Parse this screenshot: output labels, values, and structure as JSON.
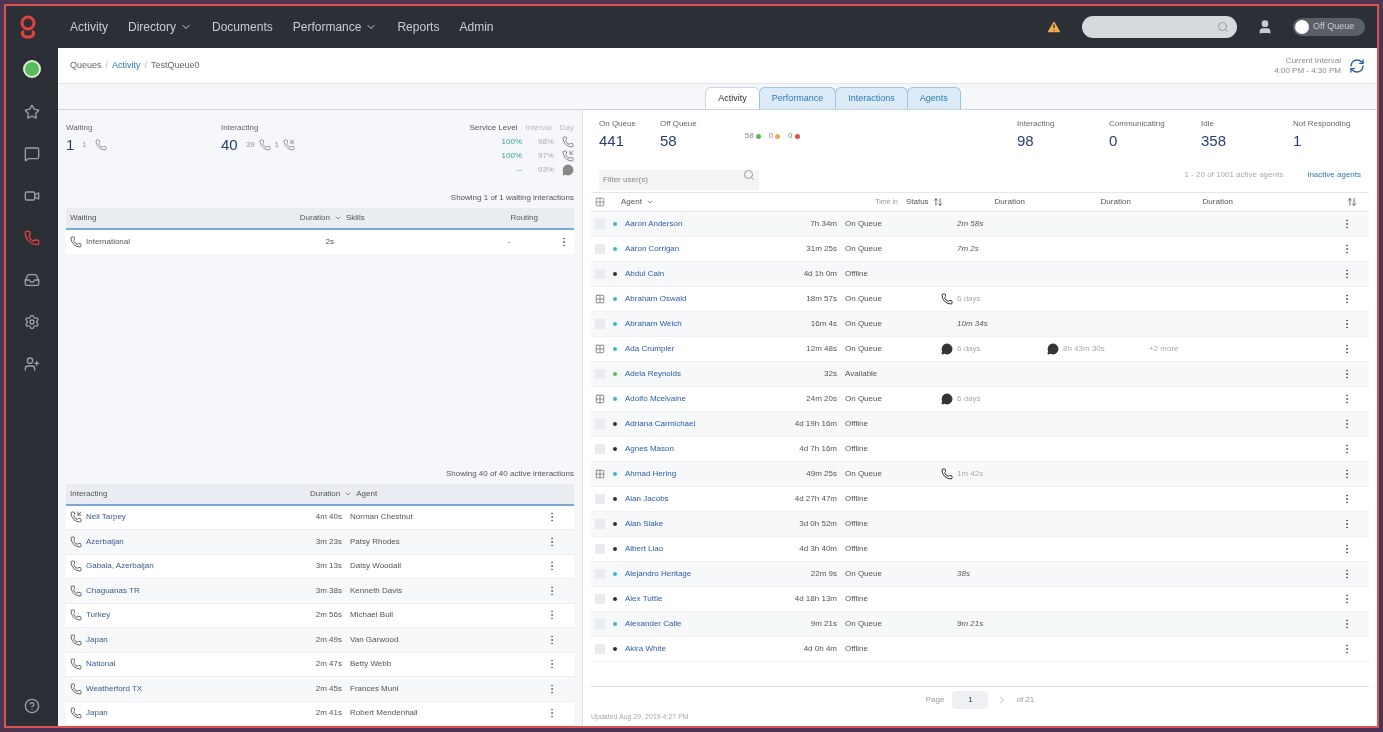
{
  "nav": {
    "items": [
      {
        "label": "Activity",
        "dropdown": false
      },
      {
        "label": "Directory",
        "dropdown": true
      },
      {
        "label": "Documents",
        "dropdown": false
      },
      {
        "label": "Performance",
        "dropdown": true
      },
      {
        "label": "Reports",
        "dropdown": false
      },
      {
        "label": "Admin",
        "dropdown": false
      }
    ],
    "status_toggle": {
      "label": "Off Queue",
      "on": false
    }
  },
  "breadcrumb": {
    "separator": "/",
    "items": [
      "Queues",
      "Activity",
      "TestQueue0"
    ]
  },
  "interval": {
    "label": "Current Interval",
    "range": "4:00 PM - 4:30 PM"
  },
  "tabs": [
    {
      "label": "Activity",
      "selected": true
    },
    {
      "label": "Performance",
      "selected": false
    },
    {
      "label": "Interactions",
      "selected": false
    },
    {
      "label": "Agents",
      "selected": false
    }
  ],
  "left": {
    "waiting": {
      "label": "Waiting",
      "value": "1",
      "calls": "1"
    },
    "interacting": {
      "label": "Interacting",
      "value": "40",
      "calls": "39",
      "callbacks": "1"
    },
    "service_level": {
      "label": "Service Level",
      "interval_label": "Interval",
      "day_label": "Day",
      "rows": [
        {
          "kind": "call",
          "interval": "100%",
          "day": "98%"
        },
        {
          "kind": "callback",
          "interval": "100%",
          "day": "97%"
        },
        {
          "kind": "chat",
          "interval": "--",
          "day": "93%"
        }
      ]
    },
    "waiting_table": {
      "summary": "Showing 1 of 1 waiting interactions",
      "columns": [
        "Waiting",
        "Duration",
        "Skills",
        "Routing"
      ],
      "rows": [
        {
          "kind": "call",
          "name": "International",
          "duration": "2s",
          "skills": "",
          "routing": "-"
        }
      ]
    },
    "interacting_table": {
      "summary": "Showing 40 of 40 active interactions",
      "columns": [
        "Interacting",
        "Duration",
        "Agent"
      ],
      "rows": [
        {
          "kind": "callback",
          "name": "Neil Tarpey",
          "duration": "4m 40s",
          "agent": "Norman Chestnut"
        },
        {
          "kind": "call",
          "name": "Azerbaijan",
          "duration": "3m 23s",
          "agent": "Patsy Rhodes"
        },
        {
          "kind": "call",
          "name": "Gabala, Azerbaijan",
          "duration": "3m 13s",
          "agent": "Daisy Woodall"
        },
        {
          "kind": "call",
          "name": "Chaguanas TR",
          "duration": "3m 38s",
          "agent": "Kenneth Davis"
        },
        {
          "kind": "call",
          "name": "Turkey",
          "duration": "2m 56s",
          "agent": "Michael Bull"
        },
        {
          "kind": "call",
          "name": "Japan",
          "duration": "2m 49s",
          "agent": "Van Garwood"
        },
        {
          "kind": "call",
          "name": "National",
          "duration": "2m 47s",
          "agent": "Betty Webb"
        },
        {
          "kind": "call",
          "name": "Weatherford TX",
          "duration": "2m 45s",
          "agent": "Frances Muni"
        },
        {
          "kind": "call",
          "name": "Japan",
          "duration": "2m 41s",
          "agent": "Robert Mendenhall"
        }
      ]
    }
  },
  "right": {
    "stats": [
      {
        "label": "On Queue",
        "value": "441"
      },
      {
        "label": "Off Queue",
        "value": "58"
      }
    ],
    "status_counts": [
      {
        "value": "58",
        "color": "#5cb85c"
      },
      {
        "value": "0",
        "color": "#f0ad4e"
      },
      {
        "value": "0",
        "color": "#d9534f"
      }
    ],
    "stats_right": [
      {
        "label": "Interacting",
        "value": "98"
      },
      {
        "label": "Communicating",
        "value": "0"
      },
      {
        "label": "Idle",
        "value": "358"
      },
      {
        "label": "Not Responding",
        "value": "1"
      }
    ],
    "filter": {
      "placeholder": "Filter user(s)"
    },
    "count": "1 - 20 of 1001 active agents",
    "inactive_link": "Inactive agents",
    "columns": [
      "Agent",
      "Time in",
      "Status",
      "Duration",
      "Duration",
      "Duration"
    ],
    "rows": [
      {
        "name": "Aaron Anderson",
        "color": "#3bb5c9",
        "time": "7h 34m",
        "status": "On Queue",
        "expandable": false,
        "d1": {
          "kind": "none",
          "text": "2m 58s"
        }
      },
      {
        "name": "Aaron Corrigan",
        "color": "#3bb5c9",
        "time": "31m 25s",
        "status": "On Queue",
        "expandable": false,
        "d1": {
          "kind": "none",
          "text": "7m 2s"
        }
      },
      {
        "name": "Abdul Cain",
        "color": "#333333",
        "time": "4d 1h 0m",
        "status": "Offline",
        "expandable": false
      },
      {
        "name": "Abraham Oswald",
        "color": "#3bb5c9",
        "time": "18m 57s",
        "status": "On Queue",
        "expandable": true,
        "d1": {
          "kind": "call",
          "text": "6 days"
        }
      },
      {
        "name": "Abraham Welch",
        "color": "#3bb5c9",
        "time": "16m 4s",
        "status": "On Queue",
        "expandable": false,
        "d1": {
          "kind": "none",
          "text": "10m 34s"
        }
      },
      {
        "name": "Ada Crumpler",
        "color": "#3bb5c9",
        "time": "12m 48s",
        "status": "On Queue",
        "expandable": true,
        "d1": {
          "kind": "chat",
          "text": "6 days"
        },
        "d2": {
          "kind": "chat",
          "text": "8h 43m 30s"
        },
        "d3": "+2 more"
      },
      {
        "name": "Adela Reynolds",
        "color": "#5cb85c",
        "time": "32s",
        "status": "Available",
        "expandable": false
      },
      {
        "name": "Adolfo Mcelvaine",
        "color": "#3bb5c9",
        "time": "24m 20s",
        "status": "On Queue",
        "expandable": true,
        "d1": {
          "kind": "chat",
          "text": "6 days"
        }
      },
      {
        "name": "Adriana Carmichael",
        "color": "#333333",
        "time": "4d 19h 16m",
        "status": "Offline",
        "expandable": false
      },
      {
        "name": "Agnes Mason",
        "color": "#333333",
        "time": "4d 7h 16m",
        "status": "Offline",
        "expandable": false
      },
      {
        "name": "Ahmad Hering",
        "color": "#3bb5c9",
        "time": "49m 25s",
        "status": "On Queue",
        "expandable": true,
        "d1": {
          "kind": "call",
          "text": "1m 42s"
        }
      },
      {
        "name": "Alan Jacobs",
        "color": "#333333",
        "time": "4d 27h 47m",
        "status": "Offline",
        "expandable": false
      },
      {
        "name": "Alan Slake",
        "color": "#333333",
        "time": "3d 0h 52m",
        "status": "Offline",
        "expandable": false
      },
      {
        "name": "Albert Liao",
        "color": "#333333",
        "time": "4d 3h 40m",
        "status": "Offline",
        "expandable": false
      },
      {
        "name": "Alejandro Heritage",
        "color": "#3bb5c9",
        "time": "22m 9s",
        "status": "On Queue",
        "expandable": false,
        "d1": {
          "kind": "none",
          "text": "38s"
        }
      },
      {
        "name": "Alex Tuttle",
        "color": "#333333",
        "time": "4d 18h 13m",
        "status": "Offline",
        "expandable": false
      },
      {
        "name": "Alexander Calle",
        "color": "#3bb5c9",
        "time": "9m 21s",
        "status": "On Queue",
        "expandable": false,
        "d1": {
          "kind": "none",
          "text": "9m 21s"
        }
      },
      {
        "name": "Akira White",
        "color": "#333333",
        "time": "4d 0h 4m",
        "status": "Offline",
        "expandable": false
      }
    ],
    "pager": {
      "label": "Page",
      "page": "1",
      "of": "of 21"
    },
    "updated": "Updated Aug 29, 2019 4:27 PM"
  }
}
